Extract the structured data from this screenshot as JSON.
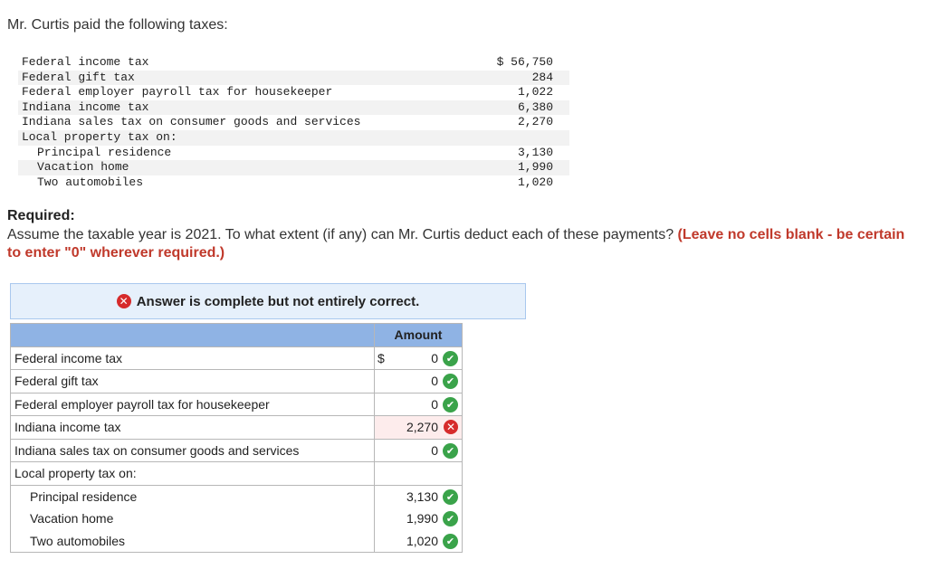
{
  "intro": "Mr. Curtis paid the following taxes:",
  "given": {
    "rows": [
      {
        "label": "Federal income tax",
        "value": "$ 56,750"
      },
      {
        "label": "Federal gift tax",
        "value": "284"
      },
      {
        "label": "Federal employer payroll tax for housekeeper",
        "value": "1,022"
      },
      {
        "label": "Indiana income tax",
        "value": "6,380"
      },
      {
        "label": "Indiana sales tax on consumer goods and services",
        "value": "2,270"
      },
      {
        "label": "Local property tax on:",
        "value": ""
      },
      {
        "label": "Principal residence",
        "value": "3,130"
      },
      {
        "label": "Vacation home",
        "value": "1,990"
      },
      {
        "label": "Two automobiles",
        "value": "1,020"
      }
    ]
  },
  "required": {
    "title": "Required:",
    "text": "Assume the taxable year is 2021. To what extent (if any) can Mr. Curtis deduct each of these payments?",
    "instruction": "(Leave no cells blank - be certain to enter \"0\" wherever required.)"
  },
  "banner": {
    "message": "Answer is complete but not entirely correct.",
    "icon": "x-circle-icon"
  },
  "answer": {
    "header": "Amount",
    "currency": "$",
    "rows": [
      {
        "label": "Federal income tax",
        "value": "0",
        "status": "correct"
      },
      {
        "label": "Federal gift tax",
        "value": "0",
        "status": "correct"
      },
      {
        "label": "Federal employer payroll tax for housekeeper",
        "value": "0",
        "status": "correct"
      },
      {
        "label": "Indiana income tax",
        "value": "2,270",
        "status": "incorrect"
      },
      {
        "label": "Indiana sales tax on consumer goods and services",
        "value": "0",
        "status": "correct"
      },
      {
        "label": "Local property tax on:",
        "value": "",
        "status": "none"
      },
      {
        "label": "Principal residence",
        "value": "3,130",
        "status": "correct"
      },
      {
        "label": "Vacation home",
        "value": "1,990",
        "status": "correct"
      },
      {
        "label": "Two automobiles",
        "value": "1,020",
        "status": "correct"
      }
    ]
  },
  "colors": {
    "correct": "#3aa34a",
    "incorrect": "#d62b2b",
    "instruction": "#c0392b",
    "header": "#8fb3e4",
    "banner": "#e6f0fb"
  }
}
